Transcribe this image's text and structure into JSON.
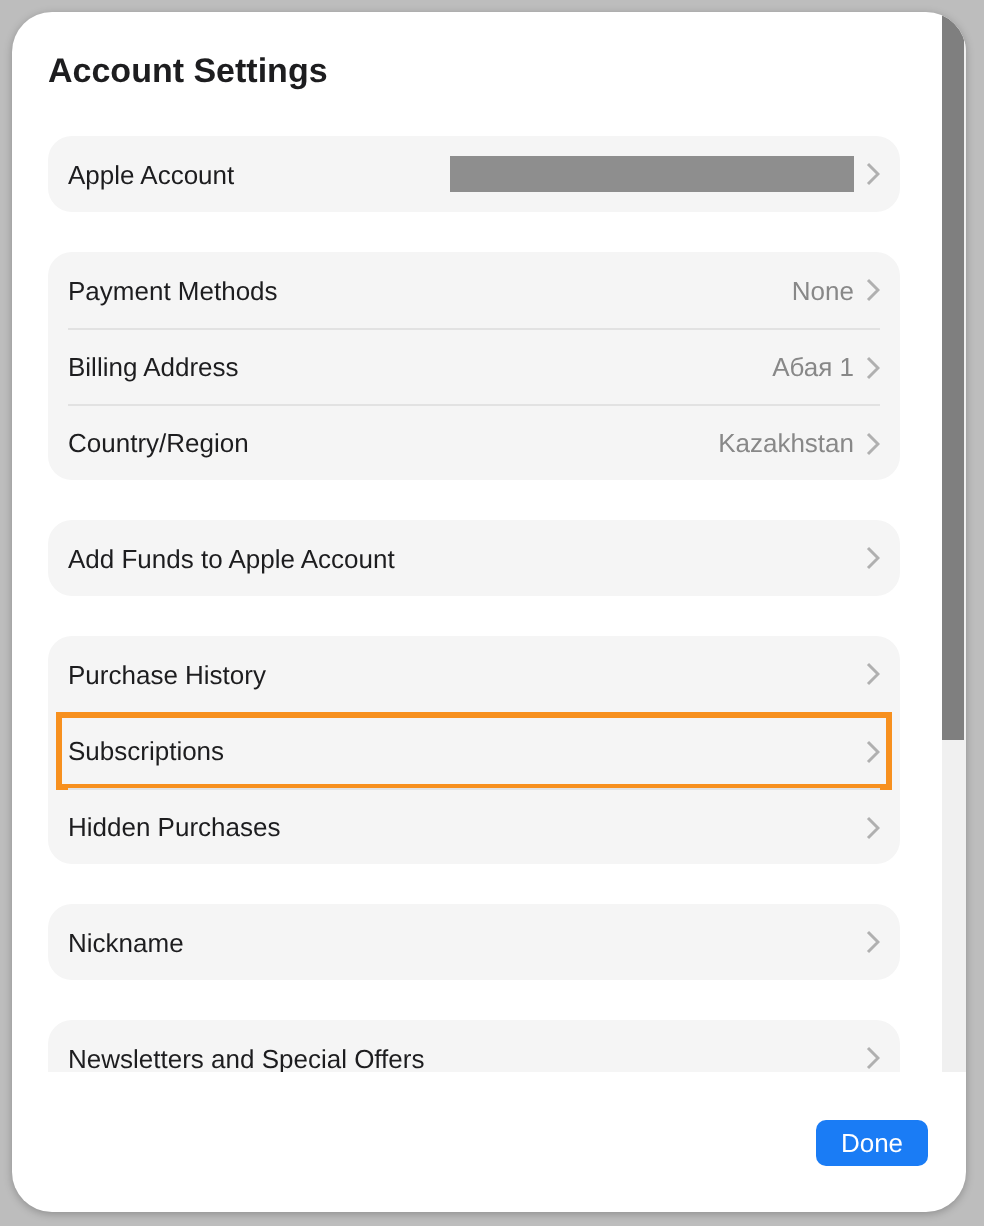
{
  "window": {
    "title": "Account Settings"
  },
  "groups": [
    {
      "rows": [
        {
          "label": "Apple Account",
          "value_redacted": true,
          "highlighted": false
        }
      ]
    },
    {
      "rows": [
        {
          "label": "Payment Methods",
          "value": "None",
          "highlighted": false
        },
        {
          "label": "Billing Address",
          "value": "Абая 1",
          "highlighted": false
        },
        {
          "label": "Country/Region",
          "value": "Kazakhstan",
          "highlighted": false
        }
      ]
    },
    {
      "rows": [
        {
          "label": "Add Funds to Apple Account",
          "highlighted": false
        }
      ]
    },
    {
      "rows": [
        {
          "label": "Purchase History",
          "highlighted": false
        },
        {
          "label": "Subscriptions",
          "highlighted": true
        },
        {
          "label": "Hidden Purchases",
          "highlighted": false
        }
      ]
    },
    {
      "rows": [
        {
          "label": "Nickname",
          "highlighted": false
        }
      ]
    },
    {
      "rows": [
        {
          "label": "Newsletters and Special Offers",
          "highlighted": false
        }
      ]
    }
  ],
  "buttons": [
    {
      "label": "Done",
      "primary": true
    }
  ]
}
